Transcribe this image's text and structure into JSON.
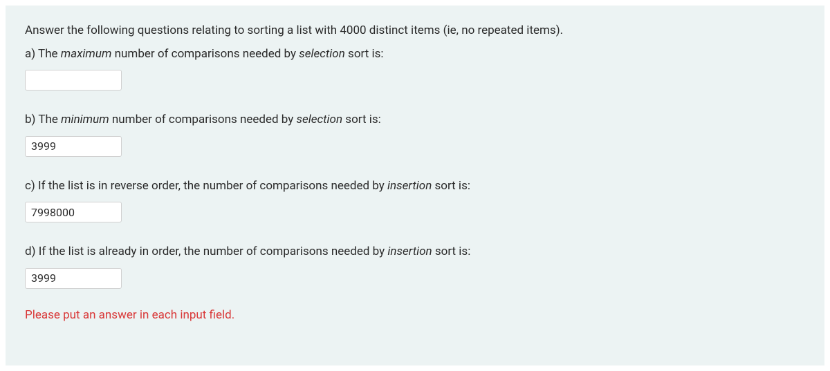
{
  "intro": "Answer the following questions relating to sorting a list with 4000 distinct items (ie, no repeated items).",
  "questions": {
    "a": {
      "prefix": "a) The ",
      "em1": "maximum",
      "mid": " number of comparisons needed by ",
      "em2": "selection",
      "suffix": " sort is:",
      "value": ""
    },
    "b": {
      "prefix": "b) The ",
      "em1": "minimum",
      "mid": " number of comparisons needed by ",
      "em2": "selection",
      "suffix": " sort is:",
      "value": "3999"
    },
    "c": {
      "prefix": "c) If the list is in reverse order, the number of comparisons needed by ",
      "em1": "insertion",
      "suffix": " sort is:",
      "value": "7998000"
    },
    "d": {
      "prefix": "d) If the list is already in order, the number of comparisons needed by ",
      "em1": "insertion",
      "suffix": " sort is:",
      "value": "3999"
    }
  },
  "error": "Please put an answer in each input field."
}
